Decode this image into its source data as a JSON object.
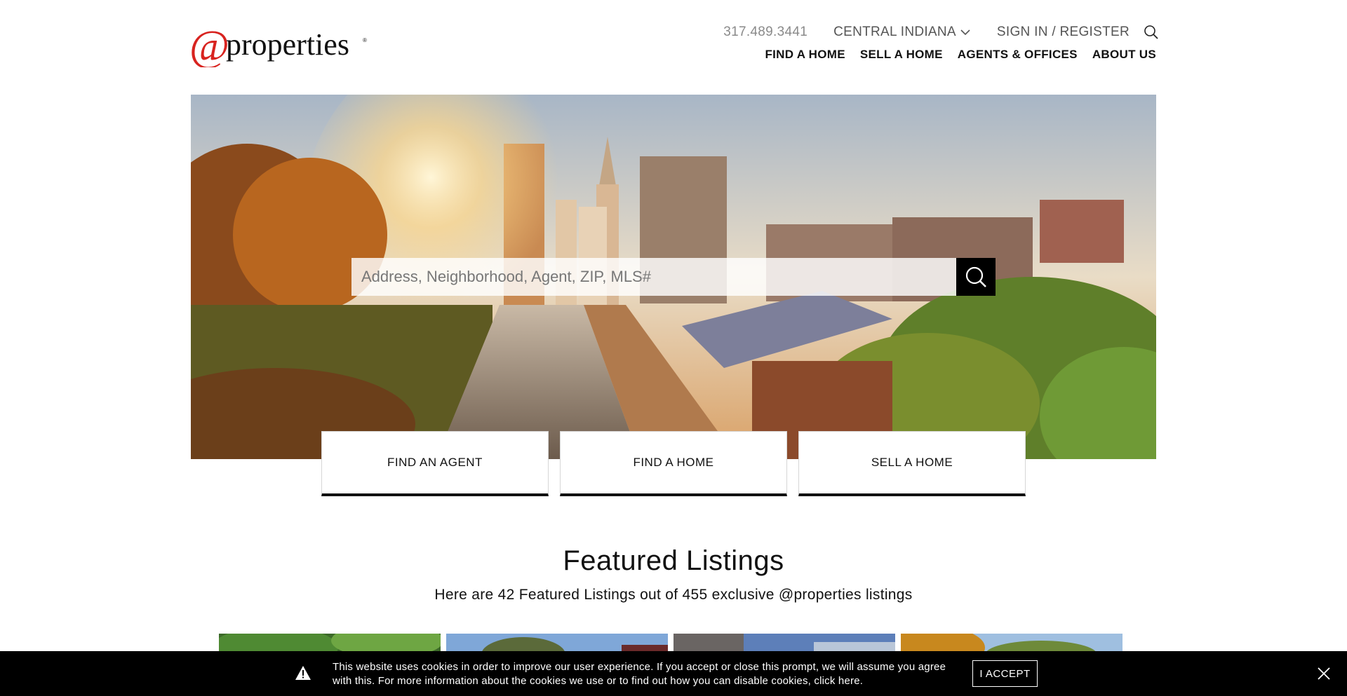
{
  "brand": {
    "logo_text": "@properties",
    "accent": "#d8231f"
  },
  "utility": {
    "phone": "317.489.3441",
    "region": "CENTRAL INDIANA",
    "signin": "SIGN IN / REGISTER",
    "search_icon": "search-icon"
  },
  "nav": {
    "items": [
      "FIND A HOME",
      "SELL A HOME",
      "AGENTS & OFFICES",
      "ABOUT US"
    ]
  },
  "hero": {
    "search_placeholder": "Address, Neighborhood, Agent, ZIP, MLS#"
  },
  "cards": [
    "FIND AN AGENT",
    "FIND A HOME",
    "SELL A HOME"
  ],
  "featured": {
    "title": "Featured Listings",
    "subtitle": "Here are 42 Featured Listings out of 455 exclusive @properties listings"
  },
  "cookie": {
    "message": "This website uses cookies in order to improve our user experience. If you accept or close this prompt, we will assume you agree with this. For more information about the cookies we use or to find out how you can disable cookies, click here.",
    "accept_label": "I ACCEPT"
  }
}
